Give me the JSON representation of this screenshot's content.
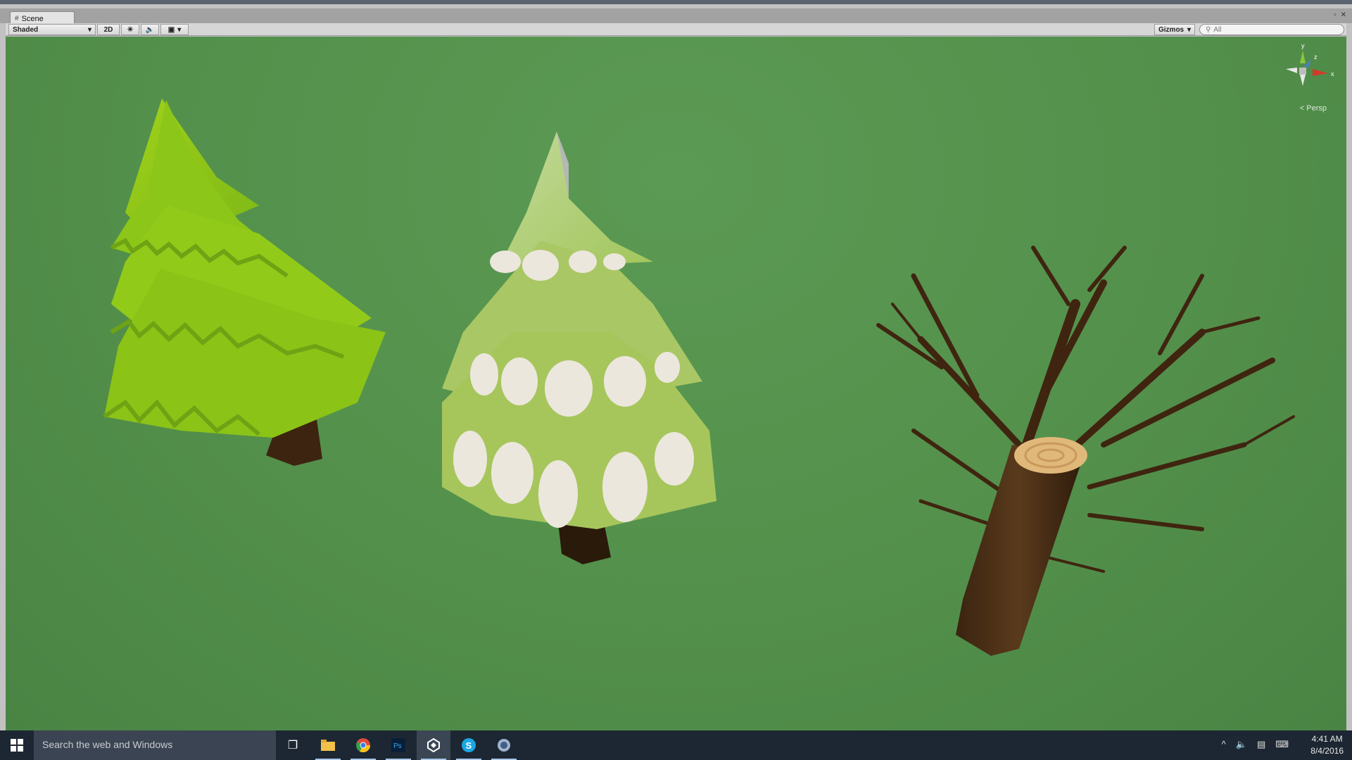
{
  "tab": {
    "title": "Scene",
    "icon": "scene-grid-icon"
  },
  "toolbar": {
    "shading_mode": "Shaded",
    "mode_2d": "2D",
    "gizmos_label": "Gizmos",
    "search_placeholder": "All"
  },
  "viewport": {
    "projection": "Persp",
    "axis_y": "y",
    "axis_z": "z",
    "axis_x": "x",
    "background_color": "#53904b"
  },
  "taskbar": {
    "search_text": "Search the web and Windows",
    "time": "4:41 AM",
    "date": "8/4/2016",
    "apps": [
      "task-view",
      "file-explorer",
      "chrome",
      "photoshop",
      "unity",
      "skype",
      "mono-develop"
    ]
  }
}
